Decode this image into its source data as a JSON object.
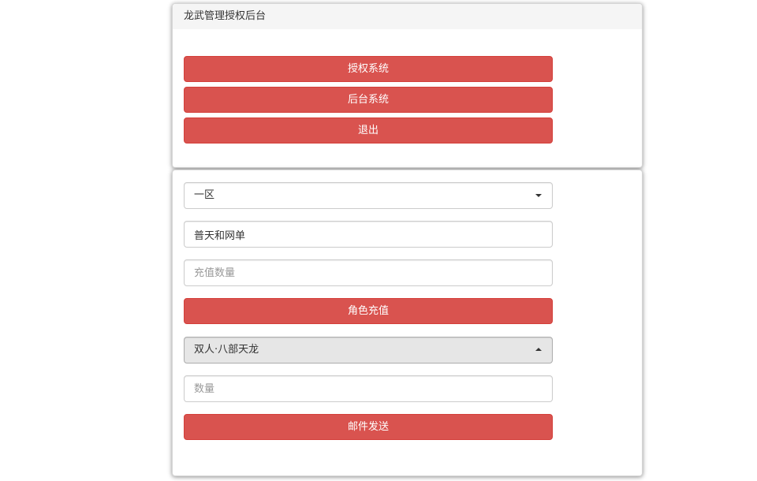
{
  "header": {
    "title": "龙武管理授权后台"
  },
  "nav": {
    "auth_system_label": "授权系统",
    "backend_system_label": "后台系统",
    "logout_label": "退出"
  },
  "recharge": {
    "server_select_value": "一区",
    "role_name_value": "普天和网单",
    "amount_placeholder": "充值数量",
    "recharge_button_label": "角色充值"
  },
  "mail": {
    "item_select_value": "双人·八部天龙",
    "quantity_placeholder": "数量",
    "send_button_label": "邮件发送"
  },
  "colors": {
    "button_red": "#d9534f",
    "heading_bg": "#f5f5f5"
  },
  "icons": {
    "select_closed": "caret-down-icon",
    "select_open": "caret-up-icon"
  }
}
